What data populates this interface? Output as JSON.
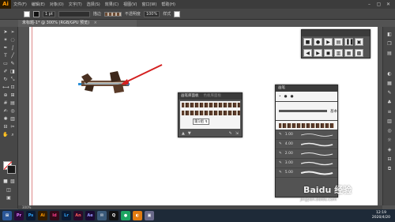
{
  "app": {
    "logo": "Ai",
    "menu": [
      "文件(F)",
      "编辑(E)",
      "对象(O)",
      "文字(T)",
      "选择(S)",
      "效果(C)",
      "视图(V)",
      "窗口(W)",
      "帮助(H)"
    ],
    "window_controls": [
      "–",
      "▢",
      "✕"
    ]
  },
  "control_bar": {
    "stroke_weight": "1 pt",
    "style_label": "描边",
    "opacity_label": "不透明度",
    "opacity_value": "100%",
    "style_name": "样式"
  },
  "document": {
    "tab_title": "未标题-1* @ 300% (RGB/GPU 预览)",
    "close": "×"
  },
  "panels": {
    "actions": {
      "tabs": [
        "",
        ""
      ],
      "row1": [
        "■",
        "●",
        "▶",
        "▤",
        "▐▐",
        "▣"
      ],
      "row2": [
        "◀",
        "▶",
        "◼",
        "▥",
        "▦",
        "▩"
      ]
    },
    "character": {
      "tabs": [
        "画笔库面板",
        "色板库面板"
      ],
      "field_label": "第1组  ↯",
      "footer": [
        "▲",
        "▼",
        "✎",
        "⇲"
      ]
    },
    "brushes": {
      "title": "画笔",
      "row_label": "基本",
      "sizes": [
        "1.00",
        "4.00",
        "2.00",
        "3.00",
        "5.00"
      ]
    }
  },
  "status": {
    "zoom": "300%"
  },
  "taskbar": {
    "apps": [
      "⊞",
      "Pr",
      "Ps",
      "Ai",
      "Id",
      "Lr",
      "An",
      "Ae",
      "✉",
      "Q",
      "●",
      "◐",
      "▣"
    ],
    "time": "12:19",
    "date": "2020/4/20"
  },
  "watermark": {
    "text": "Baidu 经验",
    "url": "jingyan.baidu.com"
  }
}
